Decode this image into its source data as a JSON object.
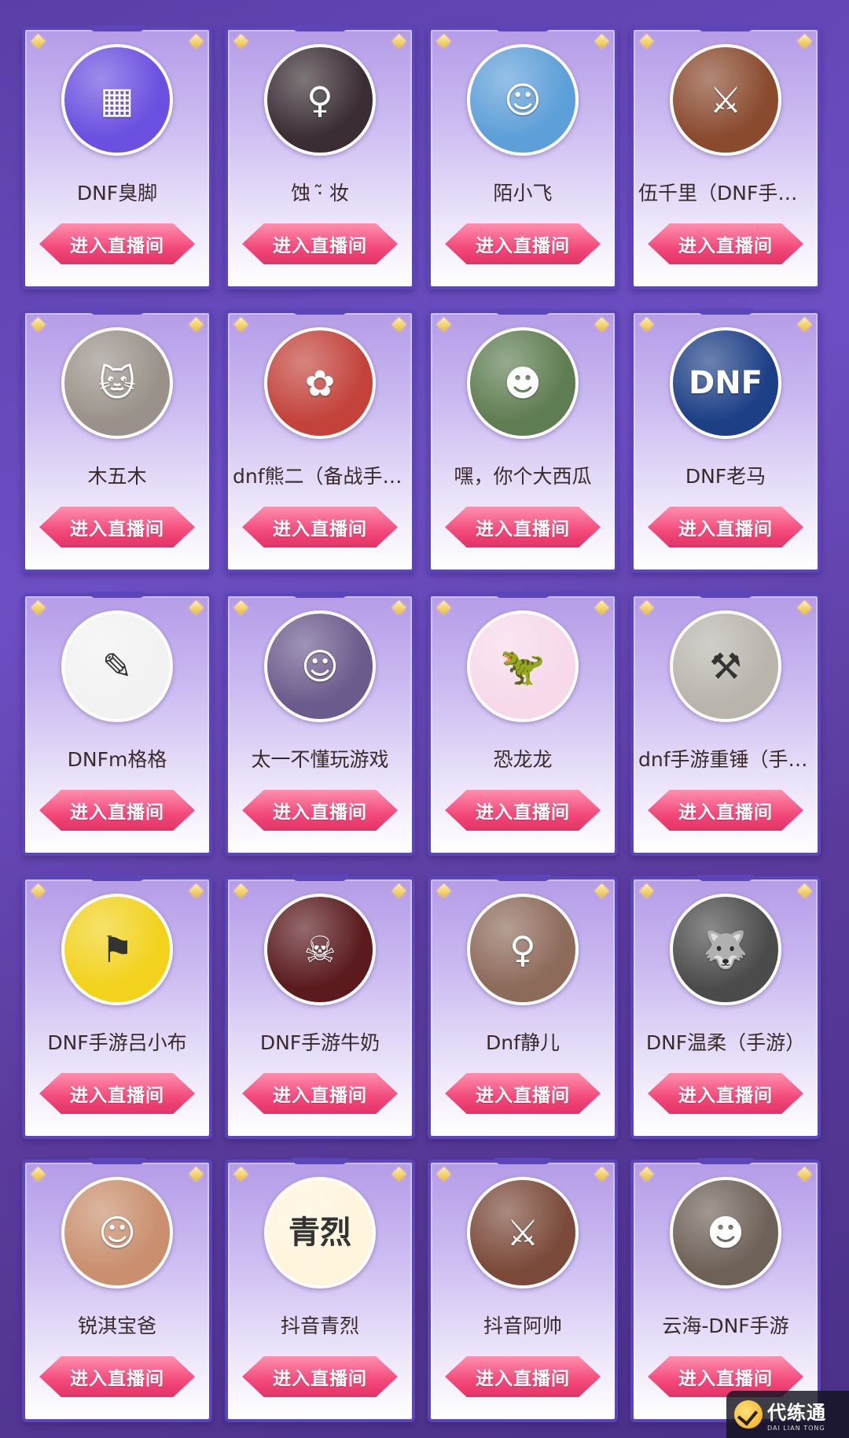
{
  "button_label": "进入直播间",
  "streamers": [
    {
      "name": "DNF臭脚",
      "avatar_icon": "qr-code-avatar",
      "avatar_color": "#6b4fe0",
      "glyph": "▦"
    },
    {
      "name": "蚀 ·̃ 妆",
      "avatar_icon": "girl-portrait-avatar",
      "avatar_color": "#3a2d33",
      "glyph": "♀"
    },
    {
      "name": "陌小飞",
      "avatar_icon": "cartoon-boy-avatar",
      "avatar_color": "#5d9fd9",
      "glyph": "☺"
    },
    {
      "name": "伍千里（DNF手游）",
      "avatar_icon": "game-characters-avatar",
      "avatar_color": "#8a4a2e",
      "glyph": "⚔"
    },
    {
      "name": "木五木",
      "avatar_icon": "cat-avatar",
      "avatar_color": "#9a928a",
      "glyph": "🐱"
    },
    {
      "name": "dnf熊二（备战手游）",
      "avatar_icon": "illustrated-girl-avatar",
      "avatar_color": "#c3433b",
      "glyph": "✿"
    },
    {
      "name": "嘿，你个大西瓜",
      "avatar_icon": "boy-photo-avatar",
      "avatar_color": "#5f7d52",
      "glyph": "☻"
    },
    {
      "name": "DNF老马",
      "avatar_icon": "dnf-logo-avatar",
      "avatar_color": "#1d3f86",
      "glyph": "DNF"
    },
    {
      "name": "DNFm格格",
      "avatar_icon": "anime-sticker-avatar",
      "avatar_color": "#f2f2f2",
      "glyph": "✎"
    },
    {
      "name": "太一不懂玩游戏",
      "avatar_icon": "glasses-boy-avatar",
      "avatar_color": "#6b5a8c",
      "glyph": "☺"
    },
    {
      "name": "恐龙龙",
      "avatar_icon": "dinosaur-avatar",
      "avatar_color": "#f7d9ea",
      "glyph": "🦖"
    },
    {
      "name": "dnf手游重锤（手游）",
      "avatar_icon": "armored-warrior-avatar",
      "avatar_color": "#b9b5ad",
      "glyph": "⚒"
    },
    {
      "name": "DNF手游吕小布",
      "avatar_icon": "chibi-warrior-avatar",
      "avatar_color": "#f2d21c",
      "glyph": "⚑"
    },
    {
      "name": "DNF手游牛奶",
      "avatar_icon": "red-demon-avatar",
      "avatar_color": "#5a1a1e",
      "glyph": "☠"
    },
    {
      "name": "Dnf静儿",
      "avatar_icon": "long-hair-girl-avatar",
      "avatar_color": "#8d6a5a",
      "glyph": "♀"
    },
    {
      "name": "DNF温柔（手游）",
      "avatar_icon": "gray-wolf-avatar",
      "avatar_color": "#4b4b4b",
      "glyph": "🐺"
    },
    {
      "name": "锐淇宝爸",
      "avatar_icon": "baby-photo-avatar",
      "avatar_color": "#c98f6e",
      "glyph": "☺"
    },
    {
      "name": "抖音青烈",
      "avatar_icon": "qinglie-text-avatar",
      "avatar_color": "#fff4dc",
      "glyph": "青烈"
    },
    {
      "name": "抖音阿帅",
      "avatar_icon": "heroines-avatar",
      "avatar_color": "#7b4a3a",
      "glyph": "⚔"
    },
    {
      "name": "云海-DNF手游",
      "avatar_icon": "young-man-avatar",
      "avatar_color": "#6e6158",
      "glyph": "☻"
    }
  ],
  "watermark": {
    "title": "代练通",
    "subtitle": "DAI LIAN TONG"
  }
}
